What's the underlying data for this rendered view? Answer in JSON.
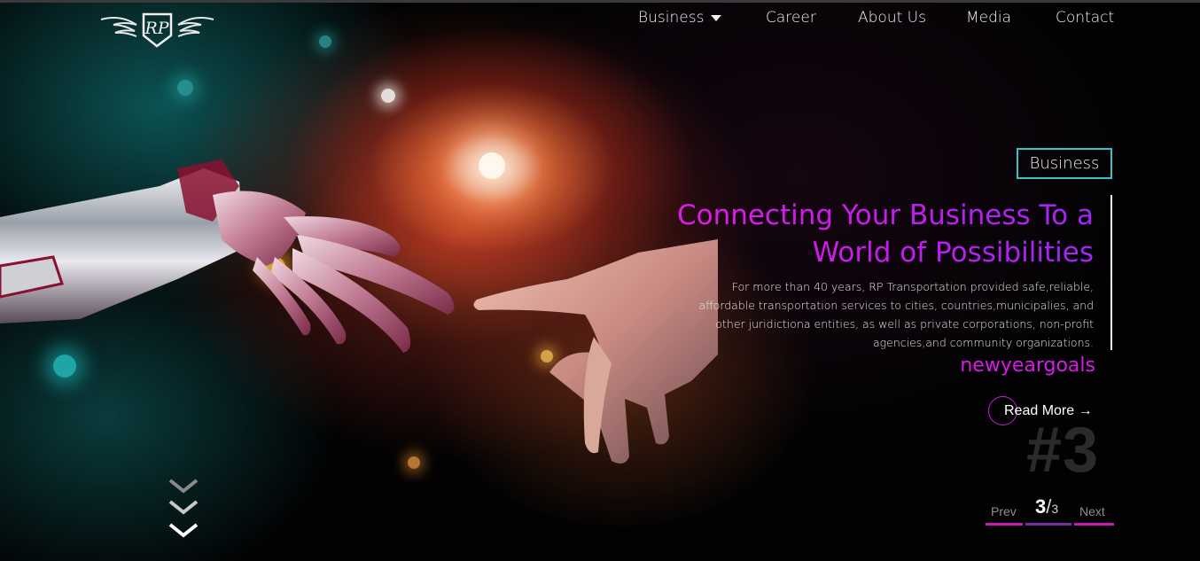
{
  "nav": {
    "items": [
      {
        "label": "Business",
        "has_dropdown": true
      },
      {
        "label": "Career"
      },
      {
        "label": "About Us"
      },
      {
        "label": "Media"
      },
      {
        "label": "Contact"
      }
    ]
  },
  "logo": {
    "text": "RP"
  },
  "slide": {
    "category": "Business",
    "headline_line1": "Connecting Your Business To a",
    "headline_line2": "World of Possibilities",
    "description": "For more than 40 years, RP Transportation provided safe,reliable, affordable transportation services to cities, countries,municipalies, and other juridictiona entities, as well as private corporations, non-profit agencies,and community organizations.",
    "hashtag": "newyeargoals",
    "read_more": "Read More",
    "read_more_arrow": "→",
    "number": "#3"
  },
  "pager": {
    "prev": "Prev",
    "next": "Next",
    "current": "3",
    "separator": "/",
    "total": "3"
  },
  "colors": {
    "accent_magenta": "#d91ae8",
    "accent_purple": "#9d28f5",
    "tag_border": "#2fc7c9"
  },
  "icons": {
    "dropdown": "caret-down-icon",
    "scroll": "chevrons-down-icon"
  }
}
